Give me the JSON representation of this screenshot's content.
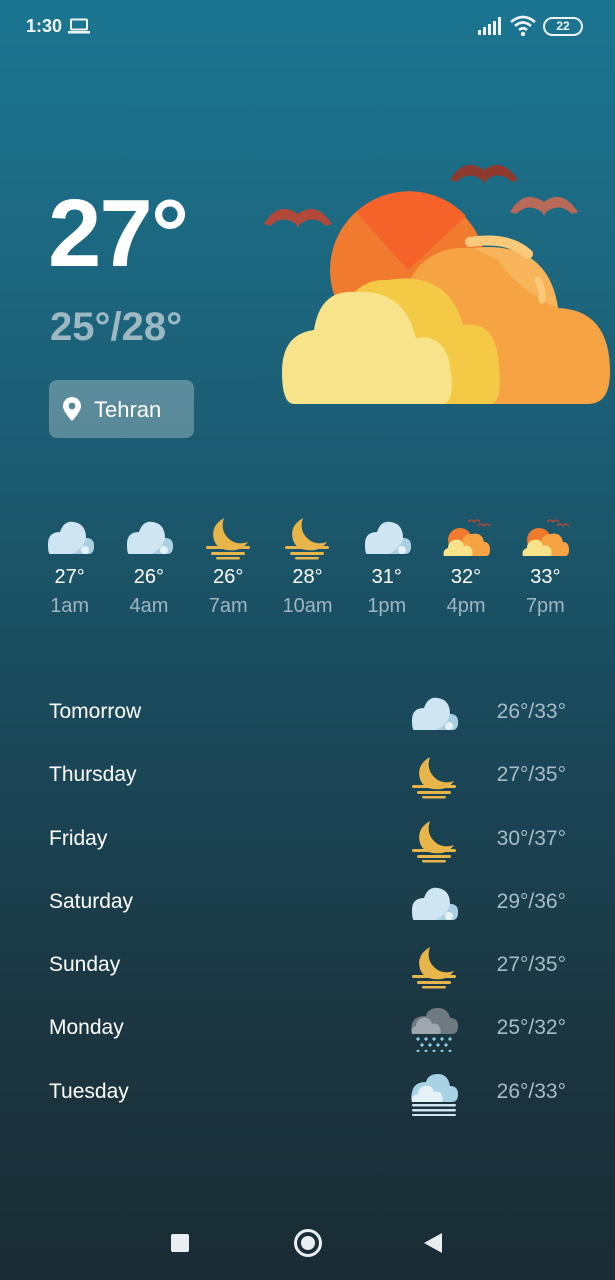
{
  "status_bar": {
    "time": "1:30",
    "battery": "22",
    "icons": [
      "laptop-icon",
      "signal-icon",
      "wifi-icon",
      "battery-icon"
    ]
  },
  "current": {
    "temperature": "27°",
    "range": "25°/28°",
    "location": "Tehran",
    "condition_icon": "sun-behind-clouds-with-birds"
  },
  "hourly": [
    {
      "temp": "27°",
      "time": "1am",
      "icon": "cloud-icon"
    },
    {
      "temp": "26°",
      "time": "4am",
      "icon": "cloud-icon"
    },
    {
      "temp": "26°",
      "time": "7am",
      "icon": "moon-icon"
    },
    {
      "temp": "28°",
      "time": "10am",
      "icon": "moon-icon"
    },
    {
      "temp": "31°",
      "time": "1pm",
      "icon": "cloud-icon"
    },
    {
      "temp": "32°",
      "time": "4pm",
      "icon": "sun-cloud-icon"
    },
    {
      "temp": "33°",
      "time": "7pm",
      "icon": "sun-cloud-icon"
    }
  ],
  "daily": [
    {
      "day": "Tomorrow",
      "range": "26°/33°",
      "icon": "cloud-icon"
    },
    {
      "day": "Thursday",
      "range": "27°/35°",
      "icon": "moon-icon"
    },
    {
      "day": "Friday",
      "range": "30°/37°",
      "icon": "moon-icon"
    },
    {
      "day": "Saturday",
      "range": "29°/36°",
      "icon": "cloud-icon"
    },
    {
      "day": "Sunday",
      "range": "27°/35°",
      "icon": "moon-icon"
    },
    {
      "day": "Monday",
      "range": "25°/32°",
      "icon": "rain-icon"
    },
    {
      "day": "Tuesday",
      "range": "26°/33°",
      "icon": "fog-icon"
    }
  ],
  "colors": {
    "accent_text": "#9cb8c3",
    "moon": "#e8b54a",
    "cloud": "#cfe6f2",
    "sun": "#f59a3a"
  }
}
